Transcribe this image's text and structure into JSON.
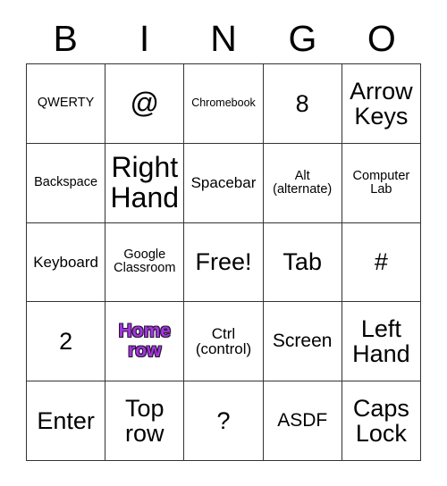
{
  "card": {
    "header_letters": [
      "B",
      "I",
      "N",
      "G",
      "O"
    ],
    "marked_color": "#a634e2",
    "marked_outline_color": "#241a30",
    "grid_line_color": "#333333",
    "background_color": "#ffffff",
    "rows": [
      [
        {
          "text": "QWERTY",
          "size": "fs-sm",
          "marked": false
        },
        {
          "text": "@",
          "size": "fs-xxl",
          "marked": false
        },
        {
          "text": "Chromebook",
          "size": "fs-xs",
          "marked": false
        },
        {
          "text": "8",
          "size": "fs-xl",
          "marked": false
        },
        {
          "text": "Arrow\nKeys",
          "size": "fs-xl",
          "marked": false
        }
      ],
      [
        {
          "text": "Backspace",
          "size": "fs-sm",
          "marked": false
        },
        {
          "text": "Right\nHand",
          "size": "fs-xxl",
          "marked": false
        },
        {
          "text": "Spacebar",
          "size": "fs-md",
          "marked": false
        },
        {
          "text": "Alt\n(alternate)",
          "size": "fs-sm",
          "marked": false
        },
        {
          "text": "Computer\nLab",
          "size": "fs-sm",
          "marked": false
        }
      ],
      [
        {
          "text": "Keyboard",
          "size": "fs-md",
          "marked": false
        },
        {
          "text": "Google\nClassroom",
          "size": "fs-sm",
          "marked": false
        },
        {
          "text": "Free!",
          "size": "fs-xl",
          "marked": false
        },
        {
          "text": "Tab",
          "size": "fs-xl",
          "marked": false
        },
        {
          "text": "#",
          "size": "fs-xl",
          "marked": false
        }
      ],
      [
        {
          "text": "2",
          "size": "fs-xl",
          "marked": false
        },
        {
          "text": "Home\nrow",
          "size": "fs-lg",
          "marked": true
        },
        {
          "text": "Ctrl\n(control)",
          "size": "fs-md",
          "marked": false
        },
        {
          "text": "Screen",
          "size": "fs-lg",
          "marked": false
        },
        {
          "text": "Left\nHand",
          "size": "fs-xl",
          "marked": false
        }
      ],
      [
        {
          "text": "Enter",
          "size": "fs-xl",
          "marked": false
        },
        {
          "text": "Top\nrow",
          "size": "fs-xl",
          "marked": false
        },
        {
          "text": "?",
          "size": "fs-xl",
          "marked": false
        },
        {
          "text": "ASDF",
          "size": "fs-lg",
          "marked": false
        },
        {
          "text": "Caps\nLock",
          "size": "fs-xl",
          "marked": false
        }
      ]
    ]
  }
}
